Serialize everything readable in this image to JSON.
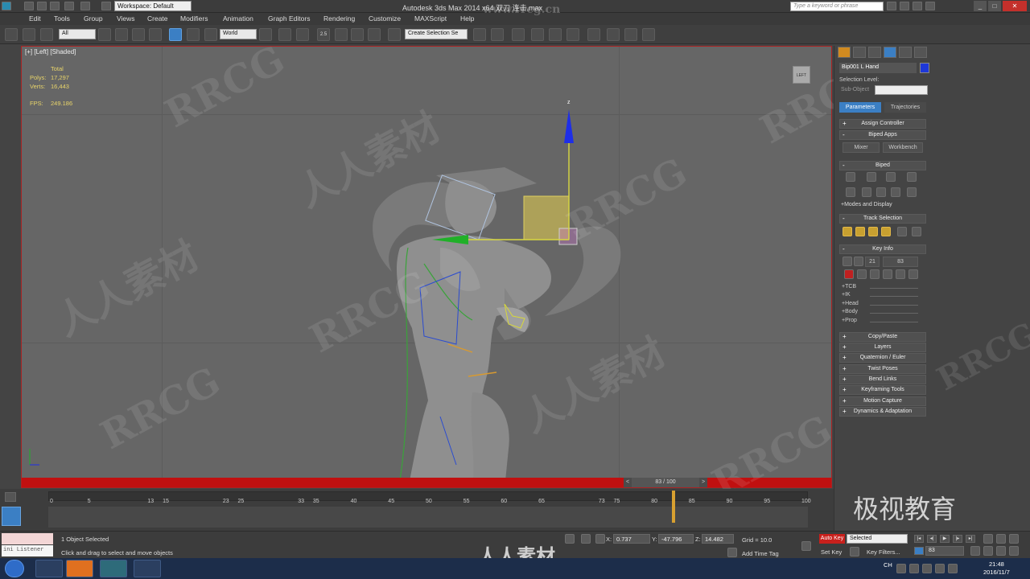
{
  "titlebar": {
    "workspace": "Workspace: Default",
    "app_title": "Autodesk 3ds Max  2014 x64     双刀  连击.max",
    "search_placeholder": "Type a keyword or phrase"
  },
  "menu": [
    "Edit",
    "Tools",
    "Group",
    "Views",
    "Create",
    "Modifiers",
    "Animation",
    "Graph Editors",
    "Rendering",
    "Customize",
    "MAXScript",
    "Help"
  ],
  "toolbar": {
    "filter": "All",
    "coord_system": "World",
    "selection_set": "Create Selection Se",
    "snap_label": "2.5"
  },
  "viewport": {
    "label": "[+] [Left] [Shaded]",
    "stats": {
      "total_label": "Total",
      "polys_label": "Polys:",
      "polys_value": "17,297",
      "verts_label": "Verts:",
      "verts_value": "16,443",
      "fps_label": "FPS:",
      "fps_value": "249.186"
    },
    "viewcube_label": "LEFT",
    "gizmo_axis_label": "z",
    "frame_display": "83 / 100"
  },
  "command_panel": {
    "object_name": "Bip001 L Hand",
    "object_color": "#1e38d8",
    "selection_level_label": "Selection Level:",
    "sub_object_label": "Sub-Object",
    "tabs": [
      "Parameters",
      "Trajectories"
    ],
    "rollouts": {
      "assign_controller": "Assign Controller",
      "biped_apps": "Biped Apps",
      "mixer": "Mixer",
      "workbench": "Workbench",
      "biped": "Biped",
      "modes_display": "+Modes and Display",
      "track_selection": "Track Selection",
      "key_info": "Key Info",
      "key_prev": "21",
      "key_next": "83",
      "sub_items": [
        "+TCB",
        "+IK",
        "+Head",
        "+Body",
        "+Prop"
      ],
      "bottom": [
        "Copy/Paste",
        "Layers",
        "Quaternion / Euler",
        "Twist Poses",
        "Bend Links",
        "Keyframing Tools",
        "Motion Capture",
        "Dynamics & Adaptation"
      ]
    }
  },
  "timeline": {
    "ticks": [
      "0",
      "5",
      "13",
      "15",
      "23",
      "25",
      "33",
      "35",
      "40",
      "45",
      "50",
      "55",
      "60",
      "65",
      "73",
      "75",
      "80",
      "85",
      "90",
      "95",
      "100"
    ],
    "current_frame": 83,
    "total_frames": 100
  },
  "statusbar": {
    "maxscript_label": "ini Listener",
    "selected_text": "1 Object Selected",
    "prompt_text": "Click and drag to select and move objects",
    "x_label": "X:",
    "x_value": "0.737",
    "y_label": "Y:",
    "y_value": "-47.796",
    "z_label": "Z:",
    "z_value": "14.482",
    "grid": "Grid = 10.0",
    "add_time_tag": "Add Time Tag",
    "auto_key": "Auto Key",
    "set_key": "Set Key",
    "selected_dropdown": "Selected",
    "key_filters": "Key Filters...",
    "frame_value": "83"
  },
  "taskbar": {
    "time": "21:48",
    "date": "2016/11/7",
    "lang": "CH"
  },
  "watermarks": {
    "rrcg": "RRCG",
    "cn": "人人素材",
    "site": "www.rrcg.cn",
    "brand": "极视教育",
    "bottom_brand": "人人素材"
  }
}
